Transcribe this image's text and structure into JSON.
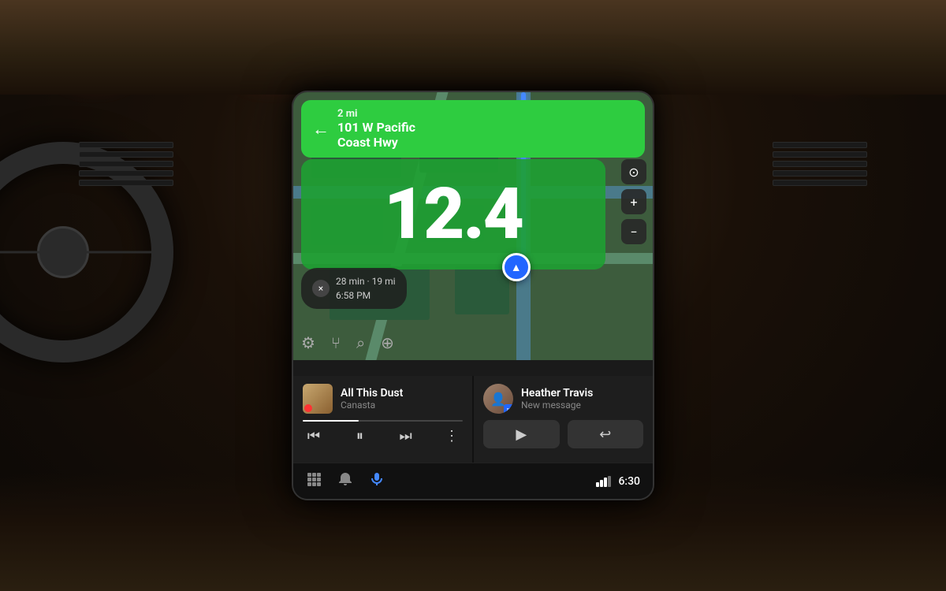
{
  "background": {
    "color": "#1a1008"
  },
  "screen": {
    "navigation": {
      "distance": "2 mi",
      "street": "101 W Pacific\nCoast Hwy",
      "speed": "12.4",
      "trip_time": "28 min · 19 mi",
      "trip_eta": "6:58 PM"
    },
    "map_controls": {
      "compass_icon": "⊙",
      "zoom_in": "+",
      "zoom_out": "−"
    },
    "nav_icons": {
      "settings": "⚙",
      "route": "⑂",
      "search": "⌕",
      "pin": "⊕"
    },
    "music": {
      "song": "All This Dust",
      "artist": "Canasta",
      "prev": "⏮",
      "play_pause": "⏸",
      "next": "⏭",
      "more": "⋮"
    },
    "message": {
      "contact": "Heather Travis",
      "preview": "New message",
      "play_icon": "▶",
      "reply_icon": "↩"
    },
    "bottom_bar": {
      "grid_icon": "⋮⋮⋮",
      "bell_icon": "🔔",
      "mic_icon": "🎤",
      "signal_icon": "▌▌▌",
      "time": "6:30"
    }
  }
}
